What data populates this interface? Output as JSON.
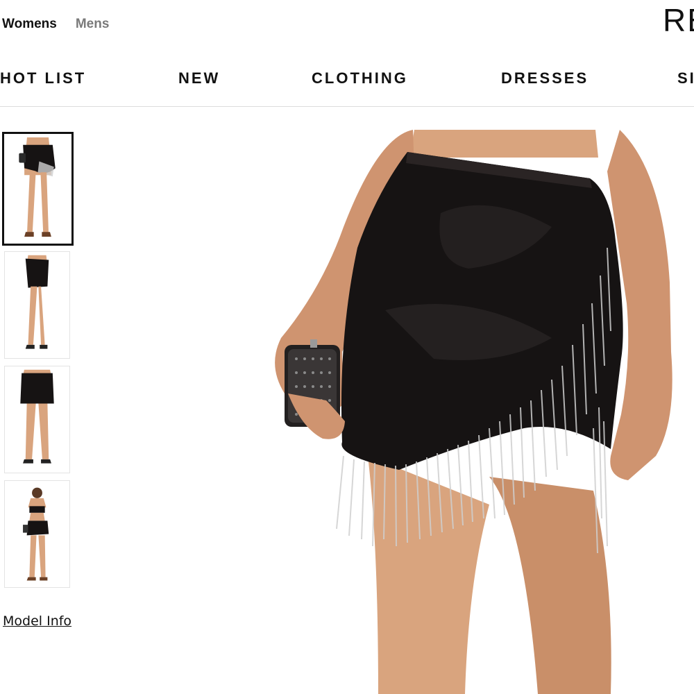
{
  "gender_nav": {
    "womens": "Womens",
    "mens": "Mens"
  },
  "brand": {
    "logo_text": "RE"
  },
  "main_nav": [
    {
      "label": "HOT LIST"
    },
    {
      "label": "NEW"
    },
    {
      "label": "CLOTHING"
    },
    {
      "label": "DRESSES"
    },
    {
      "label": "SI"
    }
  ],
  "product": {
    "thumbnails": [
      {
        "view": "front-view",
        "selected": true
      },
      {
        "view": "side-view",
        "selected": false
      },
      {
        "view": "back-view",
        "selected": false
      },
      {
        "view": "full-outfit-view",
        "selected": false
      }
    ],
    "model_info_label": "Model Info"
  },
  "colors": {
    "skin": "#d9a47e",
    "skirt": "#161313",
    "fringe": "#cfcfcf",
    "accent_text": "#111111",
    "muted_text": "#7a7a7a"
  }
}
